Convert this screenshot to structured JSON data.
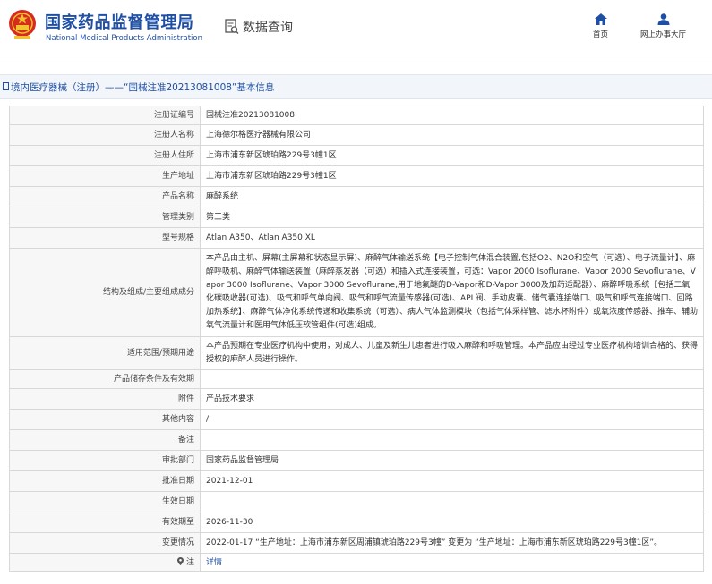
{
  "header": {
    "org_name_cn": "国家药品监督管理局",
    "org_name_en": "National Medical Products Administration",
    "query_label": "数据查询",
    "nav": [
      {
        "label": "首页",
        "icon": "home-icon"
      },
      {
        "label": "网上办事大厅",
        "icon": "user-icon"
      }
    ]
  },
  "title": "境内医疗器械（注册）——“国械注准20213081008”基本信息",
  "rows": [
    {
      "label": "注册证编号",
      "value": "国械注准20213081008"
    },
    {
      "label": "注册人名称",
      "value": "上海德尔格医疗器械有限公司"
    },
    {
      "label": "注册人住所",
      "value": "上海市浦东新区琥珀路229号3幢1区"
    },
    {
      "label": "生产地址",
      "value": "上海市浦东新区琥珀路229号3幢1区"
    },
    {
      "label": "产品名称",
      "value": "麻醉系统"
    },
    {
      "label": "管理类别",
      "value": "第三类"
    },
    {
      "label": "型号规格",
      "value": "Atlan A350、Atlan A350 XL"
    },
    {
      "label": "结构及组成/主要组成成分",
      "value": "本产品由主机、屏幕(主屏幕和状态显示屏)、麻醉气体输送系统【电子控制气体混合装置,包括O2、N2O和空气（可选）、电子流量计】、麻醉呼吸机、麻醉气体输送装置（麻醉蒸发器（可选）和插入式连接装置，可选：Vapor 2000 Isoflurane、Vapor 2000 Sevoflurane、Vapor 3000 Isoflurane、Vapor 3000 Sevoflurane,用于地氟醚的D-Vapor和D-Vapor 3000及加药适配器）、麻醉呼吸系统【包括二氧化碳吸收器(可选)、吸气和呼气单向阀、吸气和呼气流量传感器(可选)、APL阀、手动皮囊、储气囊连接端口、吸气和呼气连接端口、回路加热系统】、麻醉气体净化系统传递和收集系统（可选）、病人气体监测模块（包括气体采样管、滤水杯附件）或氧浓度传感器、推车、辅助氧气流量计和医用气体低压软管组件(可选)组成。"
    },
    {
      "label": "适用范围/预期用途",
      "value": "本产品预期在专业医疗机构中使用，对成人、儿童及新生儿患者进行吸入麻醉和呼吸管理。本产品应由经过专业医疗机构培训合格的、获得授权的麻醉人员进行操作。"
    },
    {
      "label": "产品储存条件及有效期",
      "value": ""
    },
    {
      "label": "附件",
      "value": "产品技术要求"
    },
    {
      "label": "其他内容",
      "value": "/"
    },
    {
      "label": "备注",
      "value": ""
    },
    {
      "label": "审批部门",
      "value": "国家药品监督管理局"
    },
    {
      "label": "批准日期",
      "value": "2021-12-01"
    },
    {
      "label": "生效日期",
      "value": ""
    },
    {
      "label": "有效期至",
      "value": "2026-11-30"
    },
    {
      "label": "变更情况",
      "value": "2022-01-17 “生产地址：上海市浦东新区周浦镇琥珀路229号3幢” 变更为 “生产地址：上海市浦东新区琥珀路229号3幢1区”。"
    },
    {
      "label": "注",
      "value": "详情",
      "icon": "pin-icon"
    }
  ]
}
